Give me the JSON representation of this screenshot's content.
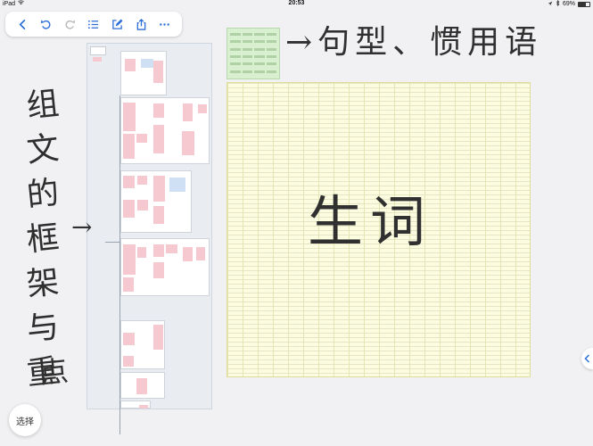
{
  "status_bar": {
    "device": "iPad",
    "wifi_icon": "wifi-icon",
    "time": "20:53",
    "battery_text": "69%",
    "battery_level": 0.69
  },
  "toolbar": {
    "buttons": [
      {
        "name": "back-button",
        "icon": "chevron-left-icon"
      },
      {
        "name": "undo-button",
        "icon": "undo-icon"
      },
      {
        "name": "redo-button",
        "icon": "redo-icon",
        "disabled": true
      },
      {
        "name": "outline-button",
        "icon": "list-icon"
      },
      {
        "name": "edit-button",
        "icon": "pencil-square-icon"
      },
      {
        "name": "share-button",
        "icon": "share-icon"
      },
      {
        "name": "more-button",
        "icon": "ellipsis-icon"
      }
    ]
  },
  "annotations": {
    "left_vertical": [
      "组",
      "文",
      "的",
      "框",
      "架",
      "与",
      "重",
      "点"
    ],
    "top_right": "→句型、惯用语",
    "center": "生词",
    "left_arrow": "→"
  },
  "select_button": {
    "label": "选择"
  },
  "side_handle": {
    "icon": "chevron-left-icon"
  },
  "colors": {
    "accent": "#2d6fd8",
    "sticky_pink": "#f6c8cf",
    "table_green": "#d8f0cf",
    "grid_yellow": "#fcfce0"
  }
}
